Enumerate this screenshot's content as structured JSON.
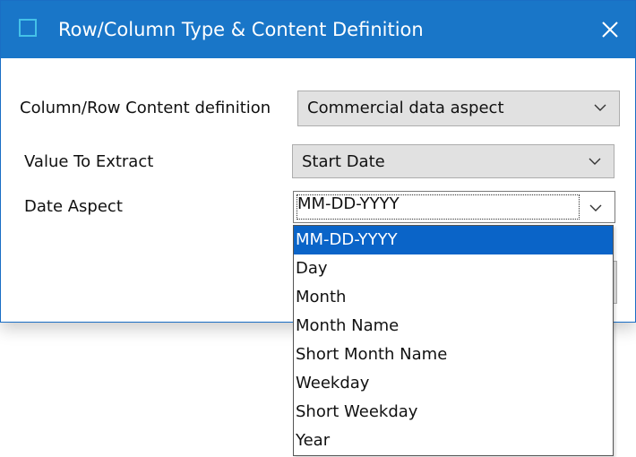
{
  "window": {
    "title": "Row/Column Type & Content Definition"
  },
  "form": {
    "content_definition": {
      "label": "Column/Row Content definition",
      "value": "Commercial data aspect"
    },
    "value_to_extract": {
      "label": "Value To Extract",
      "value": "Start Date"
    },
    "date_aspect": {
      "label": "Date Aspect",
      "value": "MM-DD-YYYY",
      "options": [
        "MM-DD-YYYY",
        "Day",
        "Month",
        "Month Name",
        "Short Month Name",
        "Weekday",
        "Short Weekday",
        "Year"
      ],
      "selected_index": 0
    }
  },
  "colors": {
    "titlebar": "#1976c8",
    "selection": "#0a64c8",
    "combo_background": "#e1e1e1"
  },
  "icons": {
    "app": "window-icon",
    "close": "close-icon",
    "dropdown": "chevron-down-icon"
  }
}
